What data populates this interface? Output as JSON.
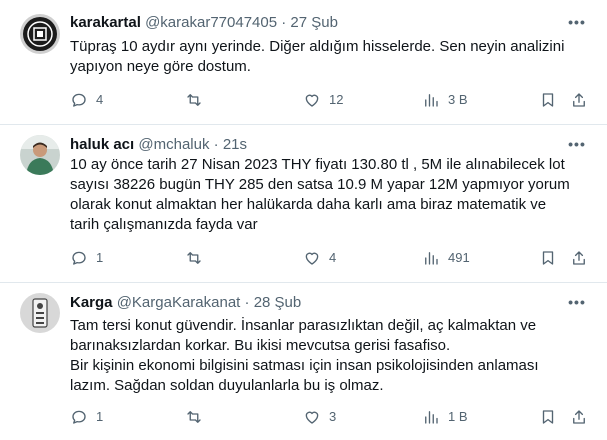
{
  "tweets": [
    {
      "name": "karakartal",
      "handle": "@karakar77047405",
      "separator": "·",
      "time": "27 Şub",
      "body": [
        "Tüpraş 10 aydır aynı yerinde. Diğer aldığım hisselerde. Sen neyin analizini yapıyon neye göre dostum."
      ],
      "replies": "4",
      "retweets": "",
      "likes": "12",
      "views": "3 B",
      "avatar_colors": [
        "#1b1b1b",
        "#ffffff"
      ]
    },
    {
      "name": "haluk acı",
      "handle": "@mchaluk",
      "separator": "·",
      "time": "21s",
      "body": [
        "10 ay önce tarih 27 Nisan 2023 THY fiyatı 130.80 tl , 5M ile alınabilecek lot sayısı 38226  bugün  THY 285 den satsa 10.9 M yapar 12M yapmıyor  yorum olarak konut almaktan her halükarda daha karlı ama biraz matematik ve tarih çalışmanızda fayda var"
      ],
      "replies": "1",
      "retweets": "",
      "likes": "4",
      "views": "491",
      "avatar_colors": [
        "#c9d3cf",
        "#3b7a5a"
      ]
    },
    {
      "name": "Karga",
      "handle": "@KargaKarakanat",
      "separator": "·",
      "time": "28 Şub",
      "body": [
        "Tam tersi konut güvendir. İnsanlar parasızlıktan değil, aç kalmaktan ve barınaksızlardan korkar. Bu ikisi mevcutsa gerisi fasafiso.",
        "Bir kişinin ekonomi bilgisini satması için insan psikolojisinden anlaması lazım. Sağdan soldan duyulanlarla bu iş olmaz."
      ],
      "replies": "1",
      "retweets": "",
      "likes": "3",
      "views": "1 B",
      "avatar_colors": [
        "#d8d8d8",
        "#444444"
      ]
    }
  ],
  "icons": {
    "more": "more-horizontal-icon",
    "reply": "reply-icon",
    "retweet": "retweet-icon",
    "like": "heart-icon",
    "views": "views-icon",
    "bookmark": "bookmark-icon",
    "share": "share-icon"
  },
  "colors": {
    "text": "#0f1419",
    "secondary": "#536471",
    "divider": "#e1e8ed"
  }
}
